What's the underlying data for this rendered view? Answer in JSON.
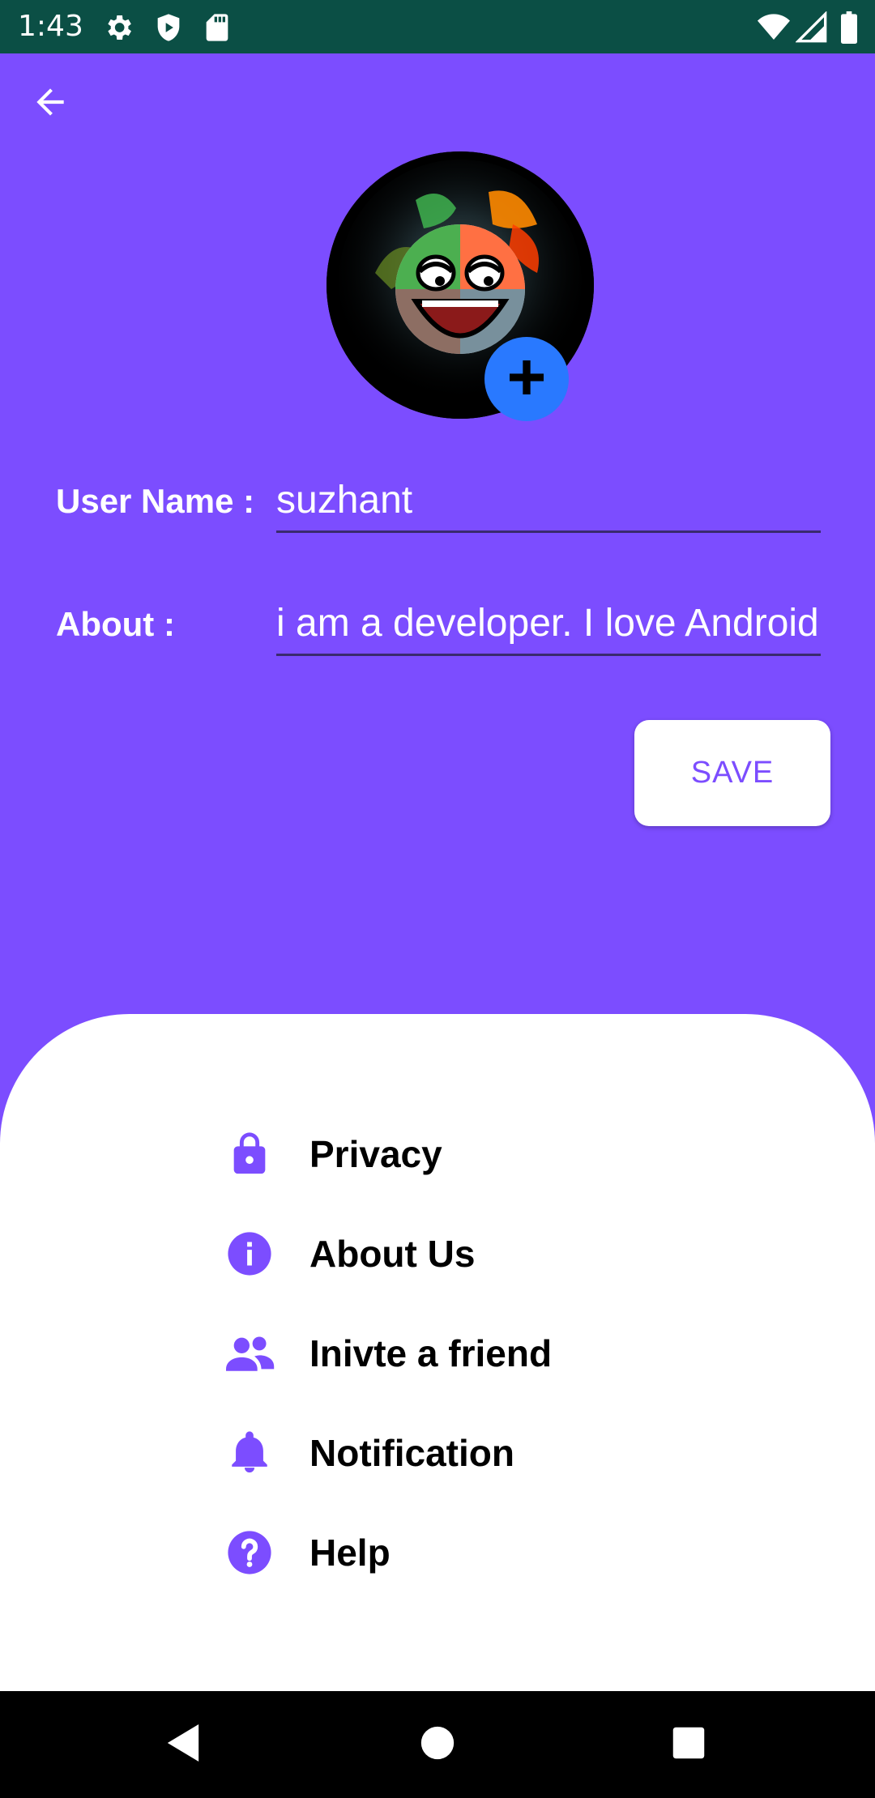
{
  "status_bar": {
    "time": "1:43",
    "icons": [
      "settings-icon",
      "shield-icon",
      "sd-card-icon",
      "wifi-icon",
      "signal-icon",
      "battery-icon"
    ]
  },
  "app_bar": {
    "back_icon": "arrow-back-icon"
  },
  "profile": {
    "avatar_icon": "avatar-image",
    "add_photo_icon": "plus-icon"
  },
  "form": {
    "username_label": "User Name :",
    "username_value": "suzhant",
    "about_label": "About :",
    "about_value": "i am a developer. I love Android",
    "save_label": "SAVE"
  },
  "menu": {
    "items": [
      {
        "label": "Privacy",
        "icon": "lock-icon"
      },
      {
        "label": "About Us",
        "icon": "info-icon"
      },
      {
        "label": "Inivte a friend",
        "icon": "people-icon"
      },
      {
        "label": "Notification",
        "icon": "bell-icon"
      },
      {
        "label": "Help",
        "icon": "help-icon"
      }
    ]
  },
  "colors": {
    "primary": "#7c4dff",
    "status_bar": "#0b4f45",
    "fab": "#2979ff",
    "panel": "#ffffff"
  },
  "nav_bar": {
    "icons": [
      "back-triangle-icon",
      "home-circle-icon",
      "recents-square-icon"
    ]
  }
}
